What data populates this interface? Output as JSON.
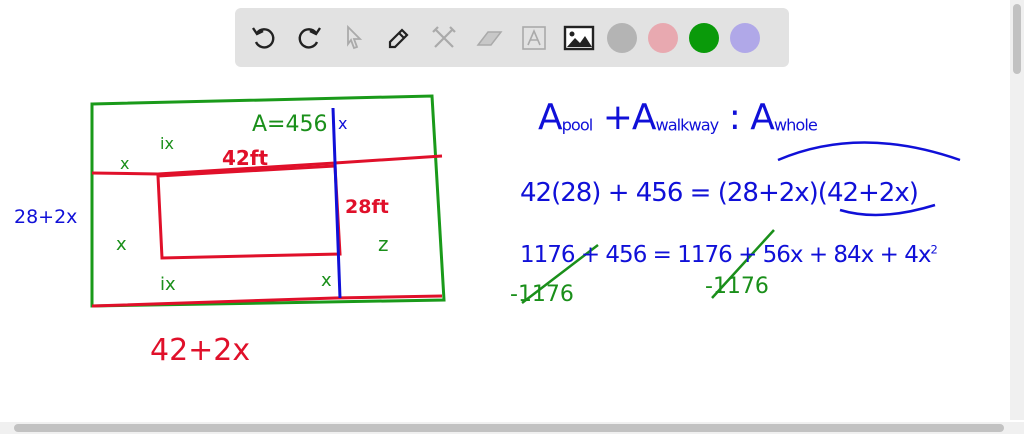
{
  "toolbar": {
    "tools": [
      "undo-icon",
      "redo-icon",
      "select-icon",
      "pen-icon",
      "tools-icon",
      "eraser-icon",
      "text-icon",
      "image-icon"
    ],
    "colors": [
      "#b4b4b4",
      "#e8a9b0",
      "#0a9a0a",
      "#b0a8e8"
    ]
  },
  "diagram": {
    "area_label": "A=456",
    "top_x": "x",
    "top_ix": "ix",
    "left_top_x": "x",
    "length_label": "42ft",
    "width_label": "28ft",
    "outer_width_label": "28+2x",
    "left_x": "x",
    "right_x": "z",
    "bottom_ix": "ix",
    "bottom_right_x": "x",
    "outer_length_label": "42+2x"
  },
  "equations": {
    "line1_a": "A",
    "line1_a_sub": "pool",
    "line1_plus": "+A",
    "line1_b_sub": "walkway",
    "line1_eq": ": A",
    "line1_c_sub": "whole",
    "line2": "42(28) + 456 = (28+2x)(42+2x)",
    "line3": "1176 + 456 = 1176 + 56x + 84x + 4x",
    "line3_exp": "2",
    "cancel_left": "-1176",
    "cancel_right": "-1176"
  }
}
